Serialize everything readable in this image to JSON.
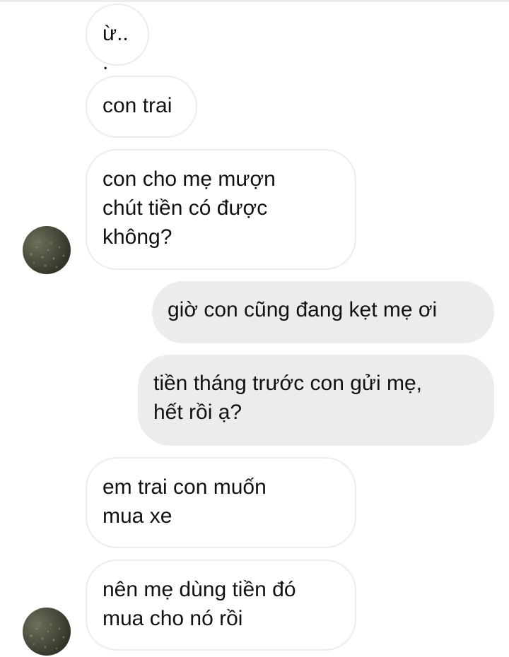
{
  "conversation": {
    "messages": [
      {
        "direction": "received",
        "text": "ừ..."
      },
      {
        "direction": "received",
        "text": "con trai"
      },
      {
        "direction": "received",
        "text": "con cho mẹ mượn\nchút tiền có được\nkhông?"
      },
      {
        "direction": "sent",
        "text": "giờ con cũng đang kẹt mẹ ơi"
      },
      {
        "direction": "sent",
        "text": "tiền tháng trước con gửi mẹ,\nhết rồi ạ?"
      },
      {
        "direction": "received",
        "text": "em trai con muốn\nmua xe"
      },
      {
        "direction": "received",
        "text": "nên mẹ dùng tiền đó\nmua cho nó rồi"
      }
    ],
    "avatar_icon": "contact-avatar-photo"
  },
  "colors": {
    "received_bubble_bg": "#ffffff",
    "received_bubble_border": "#ececec",
    "sent_bubble_bg": "#ececec",
    "text": "#111111"
  }
}
